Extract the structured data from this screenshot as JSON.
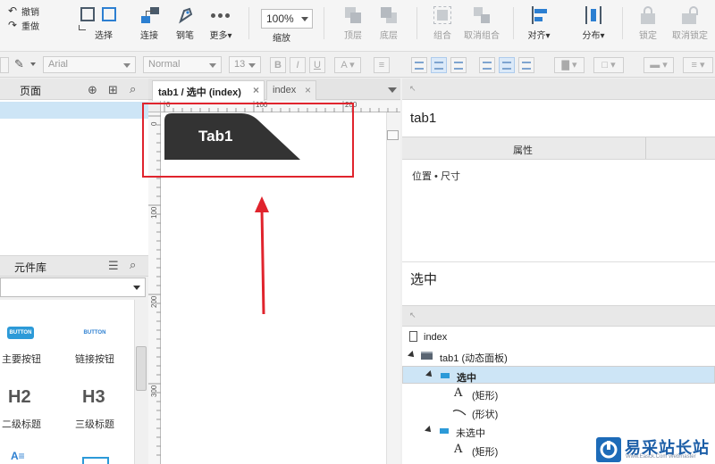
{
  "toolbar": {
    "undo": "撤销",
    "redo": "重做",
    "select": "选择",
    "connect": "连接",
    "pen": "钢笔",
    "more": "更多",
    "zoom_value": "100%",
    "zoom_label": "缩放",
    "bring_front": "顶层",
    "send_back": "底层",
    "group": "组合",
    "ungroup": "取消组合",
    "align": "对齐",
    "distribute": "分布",
    "lock": "锁定",
    "unlock": "取消锁定"
  },
  "format_bar": {
    "font": "Arial",
    "style": "Normal",
    "size": "13",
    "bold": "B",
    "italic": "I",
    "underline": "U",
    "font_color": "A"
  },
  "pages_panel": {
    "title": "页面"
  },
  "library_panel": {
    "title": "元件库",
    "items": [
      {
        "preview": "BUTTON",
        "label": "主要按钮"
      },
      {
        "preview": "BUTTON",
        "label": "链接按钮"
      },
      {
        "preview": "H2",
        "label": "二级标题"
      },
      {
        "preview": "H3",
        "label": "三级标题"
      }
    ]
  },
  "canvas": {
    "tabs": [
      {
        "label": "tab1 / 选中 (index)",
        "close": "×"
      },
      {
        "label": "index",
        "close": "×"
      }
    ],
    "ruler_top": [
      "0",
      "100",
      "200"
    ],
    "ruler_left": [
      "0",
      "100",
      "200",
      "300"
    ],
    "widget_label": "Tab1",
    "colors": {
      "highlight": "#e0242d",
      "widget_fill": "#333333"
    }
  },
  "inspector": {
    "widget_name": "tab1",
    "tab": "属性",
    "position_size": "位置 • 尺寸",
    "state_name": "选中"
  },
  "outline": {
    "items": [
      {
        "label": "index"
      },
      {
        "label": "tab1 (动态面板)"
      },
      {
        "label": "选中"
      },
      {
        "label": "(矩形)"
      },
      {
        "label": "(形状)"
      },
      {
        "label": "未选中"
      },
      {
        "label": "(矩形)"
      }
    ]
  },
  "watermark": {
    "text": "易采站长站",
    "sub": "Www.Easck.Com  Webmaster"
  }
}
